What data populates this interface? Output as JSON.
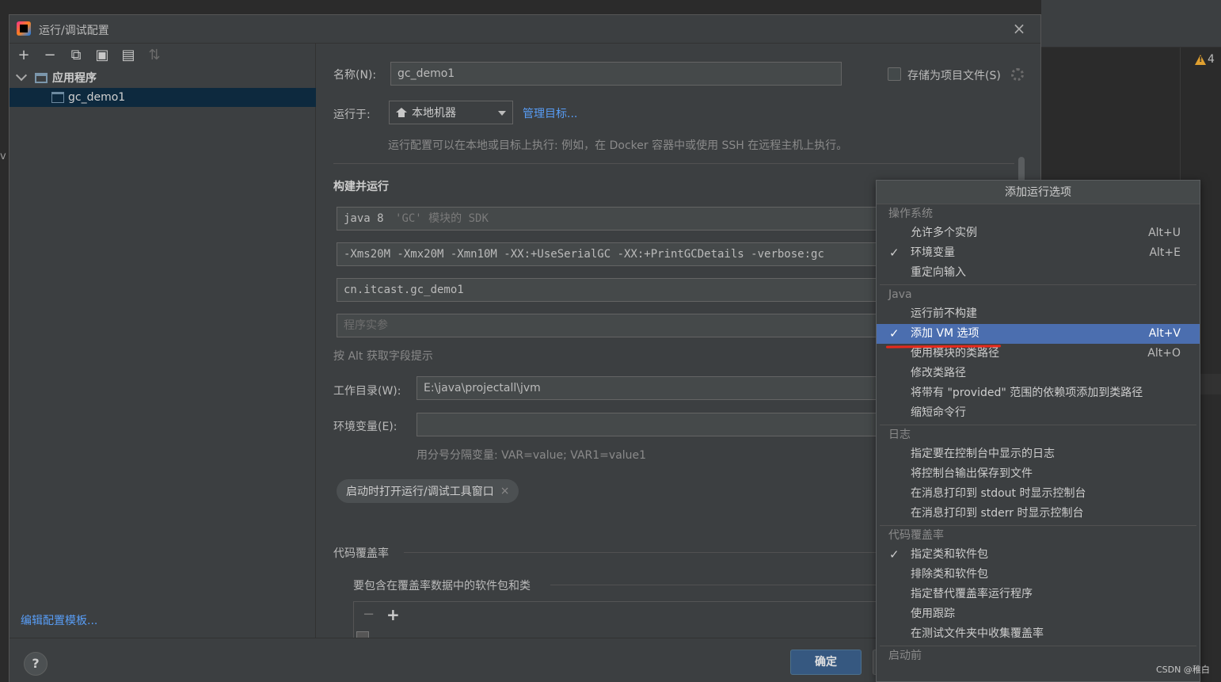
{
  "background": {
    "left_partial_text": "v",
    "warning_count": "4",
    "watermark": "CSDN @稚白"
  },
  "dialog": {
    "title": "运行/调试配置",
    "close_glyph": "×"
  },
  "left_panel": {
    "toolbar": [
      {
        "name": "add-icon",
        "glyph": "+"
      },
      {
        "name": "remove-icon",
        "glyph": "−"
      },
      {
        "name": "copy-icon",
        "glyph": "⧉"
      },
      {
        "name": "save-icon",
        "glyph": "▣"
      },
      {
        "name": "new-folder-icon",
        "glyph": "▤"
      },
      {
        "name": "sort-icon",
        "glyph": "⇅"
      }
    ],
    "tree": {
      "group_label": "应用程序",
      "child_label": "gc_demo1"
    },
    "edit_templates_link": "编辑配置模板..."
  },
  "form": {
    "name_label": "名称(N):",
    "name_value": "gc_demo1",
    "store_as_file_label": "存储为项目文件(S)",
    "run_on_label": "运行于:",
    "run_on_value": "本地机器",
    "manage_targets_link": "管理目标...",
    "run_on_hint": "运行配置可以在本地或目标上执行: 例如，在 Docker 容器中或使用 SSH 在远程主机上执行。",
    "build_run_section": "构建并运行",
    "sdk_value": "java 8",
    "sdk_hint": "'GC' 模块的 SDK",
    "vm_options_value": "-Xms20M -Xmx20M -Xmn10M -XX:+UseSerialGC -XX:+PrintGCDetails -verbose:gc",
    "main_class_value": "cn.itcast.gc_demo1",
    "program_args_placeholder": "程序实参",
    "alt_hint": "按 Alt 获取字段提示",
    "workdir_label": "工作目录(W):",
    "workdir_value": "E:\\java\\projectall\\jvm",
    "env_label": "环境变量(E):",
    "env_value": "",
    "env_hint": "用分号分隔变量: VAR=value; VAR1=value1",
    "open_tool_window_chip": "启动时打开运行/调试工具窗口",
    "chip_close_glyph": "×",
    "coverage_section": "代码覆盖率",
    "coverage_subsection": "要包含在覆盖率数据中的软件包和类",
    "coverage_minus": "−",
    "coverage_plus": "+"
  },
  "footer": {
    "help_glyph": "?",
    "ok_label": "确定"
  },
  "popup": {
    "title": "添加运行选项",
    "groups": [
      {
        "label": "操作系统",
        "items": [
          {
            "label": "允许多个实例",
            "shortcut": "Alt+U",
            "checked": false,
            "selected": false
          },
          {
            "label": "环境变量",
            "shortcut": "Alt+E",
            "checked": true,
            "selected": false
          },
          {
            "label": "重定向输入",
            "shortcut": "",
            "checked": false,
            "selected": false
          }
        ]
      },
      {
        "label": "Java",
        "items": [
          {
            "label": "运行前不构建",
            "shortcut": "",
            "checked": false,
            "selected": false
          },
          {
            "label": "添加 VM 选项",
            "shortcut": "Alt+V",
            "checked": true,
            "selected": true
          },
          {
            "label": "使用模块的类路径",
            "shortcut": "Alt+O",
            "checked": false,
            "selected": false
          },
          {
            "label": "修改类路径",
            "shortcut": "",
            "checked": false,
            "selected": false
          },
          {
            "label": "将带有 \"provided\" 范围的依赖项添加到类路径",
            "shortcut": "",
            "checked": false,
            "selected": false
          },
          {
            "label": "缩短命令行",
            "shortcut": "",
            "checked": false,
            "selected": false
          }
        ]
      },
      {
        "label": "日志",
        "items": [
          {
            "label": "指定要在控制台中显示的日志",
            "shortcut": "",
            "checked": false,
            "selected": false
          },
          {
            "label": "将控制台输出保存到文件",
            "shortcut": "",
            "checked": false,
            "selected": false
          },
          {
            "label": "在消息打印到 stdout 时显示控制台",
            "shortcut": "",
            "checked": false,
            "selected": false
          },
          {
            "label": "在消息打印到 stderr 时显示控制台",
            "shortcut": "",
            "checked": false,
            "selected": false
          }
        ]
      },
      {
        "label": "代码覆盖率",
        "items": [
          {
            "label": "指定类和软件包",
            "shortcut": "",
            "checked": true,
            "selected": false
          },
          {
            "label": "排除类和软件包",
            "shortcut": "",
            "checked": false,
            "selected": false
          },
          {
            "label": "指定替代覆盖率运行程序",
            "shortcut": "",
            "checked": false,
            "selected": false
          },
          {
            "label": "使用跟踪",
            "shortcut": "",
            "checked": false,
            "selected": false
          },
          {
            "label": "在测试文件夹中收集覆盖率",
            "shortcut": "",
            "checked": false,
            "selected": false
          }
        ]
      },
      {
        "label": "启动前",
        "items": []
      }
    ],
    "check_glyph": "✓"
  },
  "colors": {
    "accent": "#4b6eaf",
    "link": "#589df6",
    "annotation": "#e8291c"
  }
}
